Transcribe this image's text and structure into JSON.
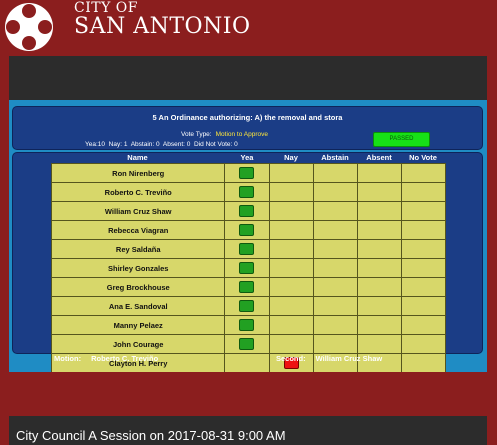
{
  "site": {
    "city_of": "CITY OF",
    "city_name": "SAN ANTONIO",
    "logo_icon": "city-seal-icon"
  },
  "vote": {
    "title": "5 An Ordinance authorizing: A) the removal and stora",
    "vote_type_label": "Vote Type:",
    "vote_type_value": "Motion to Approve",
    "yea_label": "Yea:",
    "yea": 10,
    "nay_label": "Nay:",
    "nay": 1,
    "abstain_label": "Abstain:",
    "abstain": 0,
    "absent_label": "Absent:",
    "absent": 0,
    "did_not_vote_label": "Did Not Vote:",
    "did_not_vote": 0,
    "result": "PASSED"
  },
  "columns": [
    "Name",
    "Yea",
    "Nay",
    "Abstain",
    "Absent",
    "No Vote"
  ],
  "members": [
    {
      "name": "Ron Nirenberg",
      "vote": "Yea"
    },
    {
      "name": "Roberto C. Treviño",
      "vote": "Yea"
    },
    {
      "name": "William Cruz Shaw",
      "vote": "Yea"
    },
    {
      "name": "Rebecca Viagran",
      "vote": "Yea"
    },
    {
      "name": "Rey Saldaña",
      "vote": "Yea"
    },
    {
      "name": "Shirley Gonzales",
      "vote": "Yea"
    },
    {
      "name": "Greg Brockhouse",
      "vote": "Yea"
    },
    {
      "name": "Ana E. Sandoval",
      "vote": "Yea"
    },
    {
      "name": "Manny Pelaez",
      "vote": "Yea"
    },
    {
      "name": "John Courage",
      "vote": "Yea"
    },
    {
      "name": "Clayton H. Perry",
      "vote": "Nay"
    }
  ],
  "motion": {
    "label": "Motion:",
    "value": "Roberto C. Treviño"
  },
  "second": {
    "label": "Second:",
    "value": "William Cruz Shaw"
  },
  "caption": "City Council A Session on 2017-08-31 9:00 AM",
  "colors": {
    "brand": "#8b1e1e",
    "panel": "#1b3d86",
    "yea": "#22a022",
    "nay": "#ee1111",
    "passed": "#17e017",
    "cell": "#d7d76a"
  }
}
